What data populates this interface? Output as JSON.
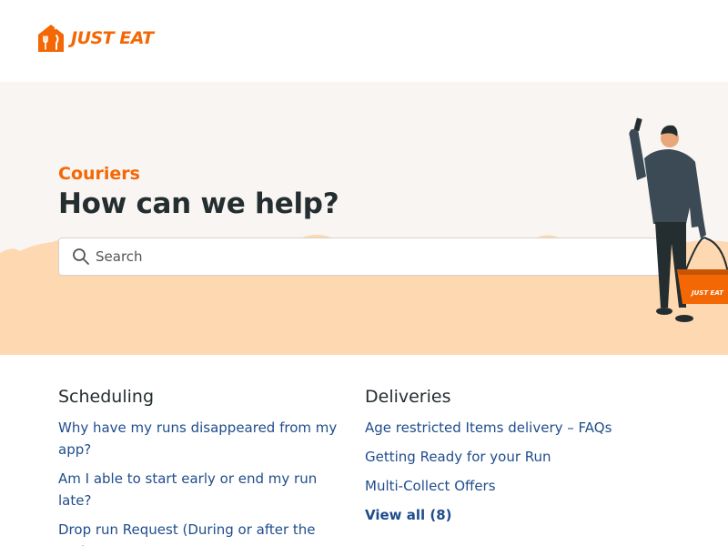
{
  "header": {
    "logo_text": "JUST EAT",
    "logo_icon": "house-fork-knife-logo",
    "brand_color": "#f36805"
  },
  "hero": {
    "subtitle": "Couriers",
    "title": "How can we help?",
    "search": {
      "placeholder": "Search",
      "value": "",
      "icon": "search-icon"
    },
    "illustration": "courier-with-basket-illustration",
    "basket_text": "JUST EAT",
    "background_color": "#f9f5f2",
    "hill_color": "#fdd8b0"
  },
  "categories": [
    {
      "title": "Scheduling",
      "articles": [
        "Why have my runs disappeared from my app?",
        "Am I able to start early or end my run late?",
        "Drop run Request (During or after the run)"
      ]
    },
    {
      "title": "Deliveries",
      "articles": [
        "Age restricted Items delivery – FAQs",
        "Getting Ready for your Run",
        "Multi-Collect Offers"
      ],
      "view_all": "View all (8)"
    }
  ],
  "link_color": "#1f4d8c"
}
